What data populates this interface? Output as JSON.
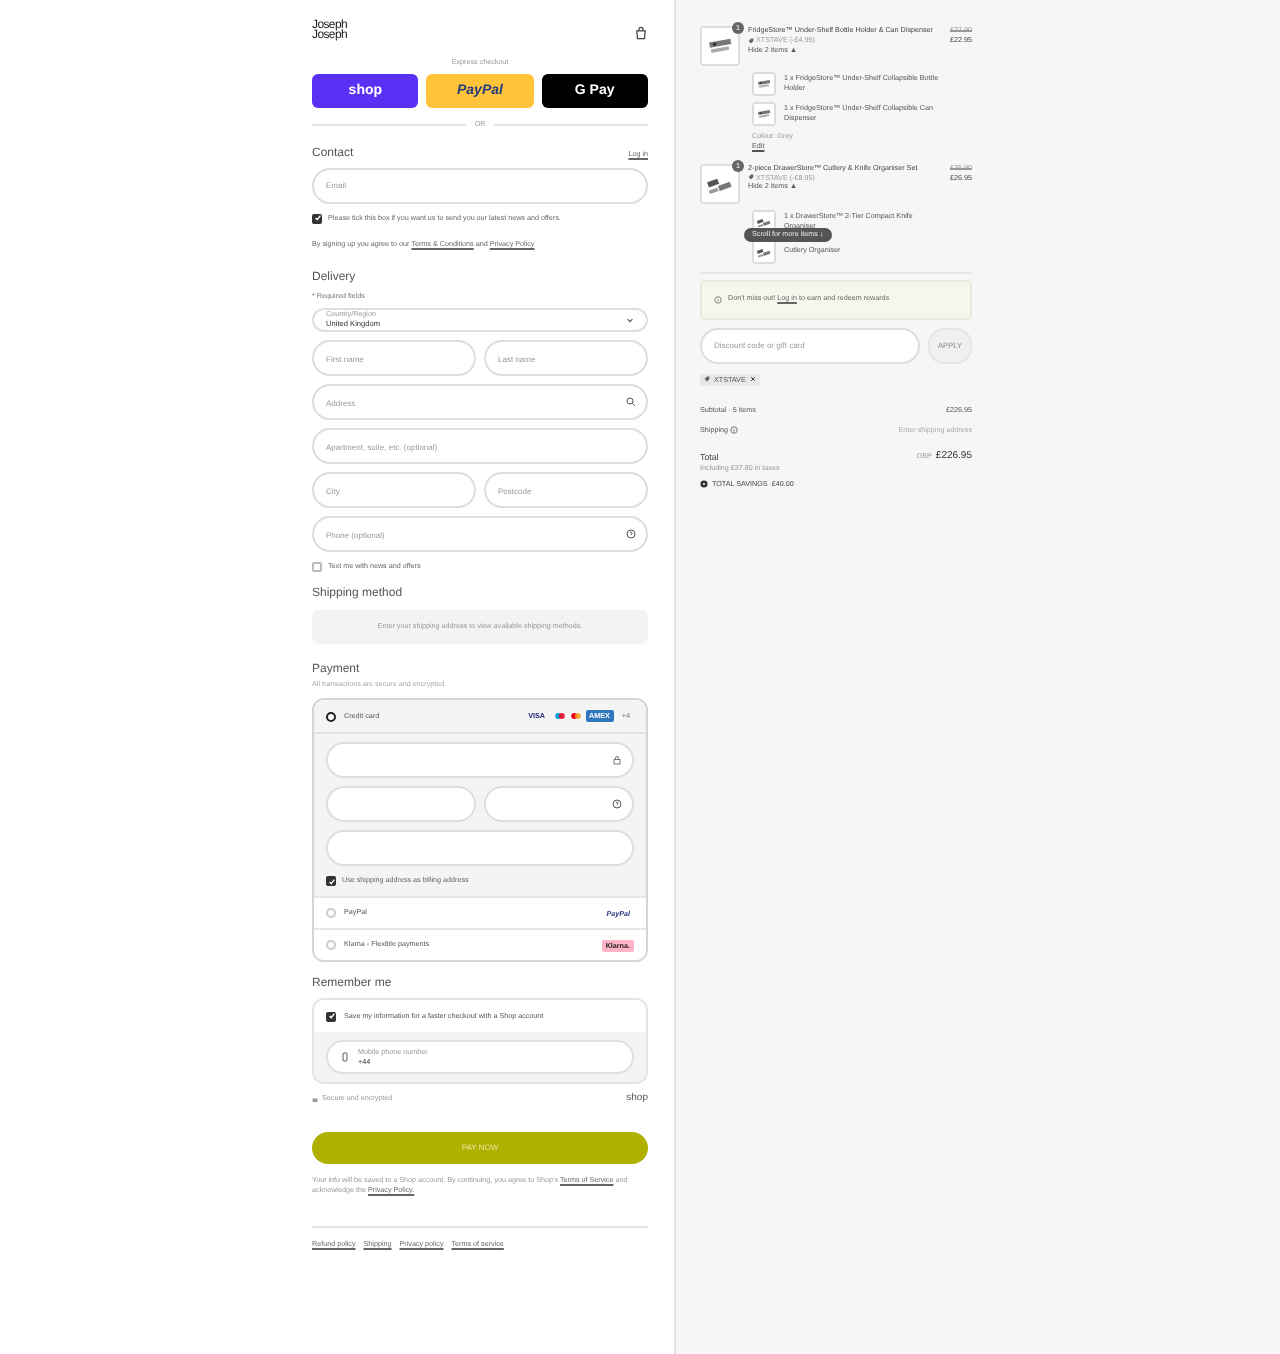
{
  "header": {
    "logo": [
      "Joseph",
      "Joseph"
    ]
  },
  "express": {
    "title": "Express checkout",
    "buttons": [
      {
        "kind": "shop",
        "label": "shop"
      },
      {
        "kind": "paypal",
        "label": "PayPal"
      },
      {
        "kind": "gpay",
        "label": "G Pay"
      }
    ],
    "divider": "OR"
  },
  "contact": {
    "title": "Contact",
    "login": "Log in",
    "email": {
      "placeholder": "Email"
    },
    "newsletter": {
      "checked": true,
      "label": "Please tick this box if you want us to send you our latest news and offers."
    },
    "terms": {
      "before": "By signing up you agree to our",
      "link1": "Terms & Conditions",
      "middle": "and",
      "link2": "Privacy Policy"
    }
  },
  "delivery": {
    "title": "Delivery",
    "required": "* Required fields",
    "country": {
      "label": "Country/Region",
      "value": "United Kingdom"
    },
    "fields": [
      {
        "placeholder": "First name",
        "placeholder2": "Last name",
        "kind": "pair"
      },
      {
        "placeholder": "Address",
        "kind": "search"
      },
      {
        "placeholder": "Apartment, suite, etc. (optional)",
        "kind": "plain"
      },
      {
        "placeholder": "City",
        "placeholder2": "Postcode",
        "kind": "pair"
      },
      {
        "placeholder": "Phone (optional)",
        "kind": "help"
      }
    ],
    "sms": {
      "checked": false,
      "label": "Text me with news and offers"
    }
  },
  "shipping": {
    "title": "Shipping method",
    "message": "Enter your shipping address to view available shipping methods."
  },
  "payment": {
    "title": "Payment",
    "subtitle": "All transactions are secure and encrypted.",
    "methods": [
      {
        "kind": "card",
        "label": "Credit card",
        "selected": true,
        "brands": [
          "VISA",
          "AMEX",
          "+4"
        ],
        "billing": {
          "checked": true,
          "label": "Use shipping address as billing address"
        }
      },
      {
        "kind": "paypal",
        "label": "PayPal",
        "selected": false,
        "badge": "PayPal"
      },
      {
        "kind": "klarna",
        "label": "Klarna - Flexible payments",
        "selected": false,
        "badge": "Klarna."
      }
    ]
  },
  "remember": {
    "title": "Remember me",
    "save": {
      "checked": true,
      "label": "Save my information for a faster checkout with a Shop account"
    },
    "phone": {
      "label": "Mobile phone number",
      "value": "+44"
    },
    "secure": "Secure and encrypted",
    "shop": "shop"
  },
  "pay": {
    "label": "PAY NOW"
  },
  "notice": {
    "before": "Your info will be saved to a Shop account. By continuing, you agree to Shop's",
    "link1": "Terms of Service",
    "middle": "and acknowledge the",
    "link2": "Privacy Policy."
  },
  "footer": [
    "Refund policy",
    "Shipping",
    "Privacy policy",
    "Terms of service"
  ],
  "cart": {
    "items": [
      {
        "quantity": "1",
        "title": "FridgeStore™ Under-Shelf Bottle Holder & Can Dispenser",
        "old_price": "£27.90",
        "price": "£22.95",
        "discount": "XTSTAVE (-£4.95)",
        "toggle": "Hide 2 items ▲",
        "children": [
          {
            "title": "1 x FridgeStore™ Under-Shelf Collapsible Bottle Holder"
          },
          {
            "title": "1 x FridgeStore™ Under-Shelf Collapsible Can Dispenser"
          }
        ],
        "variant": "Colour: Grey",
        "edit": "Edit"
      },
      {
        "quantity": "1",
        "title": "2-piece DrawerStore™ Cutlery & Knife Organiser Set",
        "old_price": "£35.90",
        "price": "£26.95",
        "discount": "XTSTAVE (-£8.95)",
        "toggle": "Hide 2 items ▲",
        "children": [
          {
            "title": "1 x DrawerStore™ 2-Tier Compact Knife Organiser"
          },
          {
            "title": "Cutlery Organiser"
          }
        ]
      }
    ],
    "scroll_hint": "Scroll for more items ↓",
    "rewards": {
      "before": "Don't miss out!",
      "link": "Log in",
      "after": "to earn and redeem rewards"
    },
    "discount": {
      "placeholder": "Discount code or gift card",
      "apply": "APPLY",
      "disabled": true
    },
    "code_tag": "XTSTAVE",
    "summary": [
      {
        "label": "Subtotal · 5 items",
        "value": "£226.95",
        "kind": "plain"
      },
      {
        "label": "Shipping",
        "value": "Enter shipping address",
        "kind": "info"
      }
    ],
    "total": {
      "label": "Total",
      "currency": "GBP",
      "value": "£226.95",
      "taxes": "Including £37.80 in taxes"
    },
    "savings": {
      "label": "TOTAL SAVINGS",
      "value": "£40.00"
    }
  }
}
